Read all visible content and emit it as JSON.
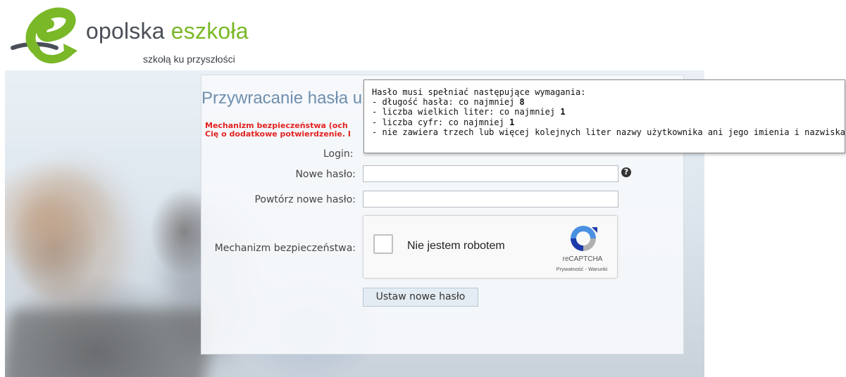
{
  "header": {
    "brand_prefix": "opolska ",
    "brand_accent": "eszkoła",
    "tagline": "szkołą ku przyszłości",
    "accent_color": "#7ab828"
  },
  "page": {
    "title": "Przywracanie hasła u",
    "warning_line1": "Mechanizm bezpieczeństwa (och",
    "warning_line2": "Cię o dodatkowe potwierdzenie. I"
  },
  "form": {
    "login_label": "Login:",
    "new_password_label": "Nowe hasło:",
    "new_password_value": "",
    "repeat_password_label": "Powtórz nowe hasło:",
    "repeat_password_value": "",
    "security_label": "Mechanizm bezpieczeństwa:",
    "help_icon": "?",
    "submit_label": "Ustaw nowe hasło"
  },
  "recaptcha": {
    "label": "Nie jestem robotem",
    "brand": "reCAPTCHA",
    "privacy": "Prywatność",
    "separator": " - ",
    "terms": "Warunki"
  },
  "tooltip": {
    "heading": "Hasło musi spełniać następujące wymagania:",
    "req1_text": "- długość hasła: co najmniej ",
    "req1_value": "8",
    "req2_text": "- liczba wielkich liter: co najmniej ",
    "req2_value": "1",
    "req3_text": "- liczba cyfr: co najmniej ",
    "req3_value": "1",
    "req4_text": "- nie zawiera trzech lub więcej kolejnych liter nazwy użytkownika ani jego imienia i nazwiska"
  }
}
